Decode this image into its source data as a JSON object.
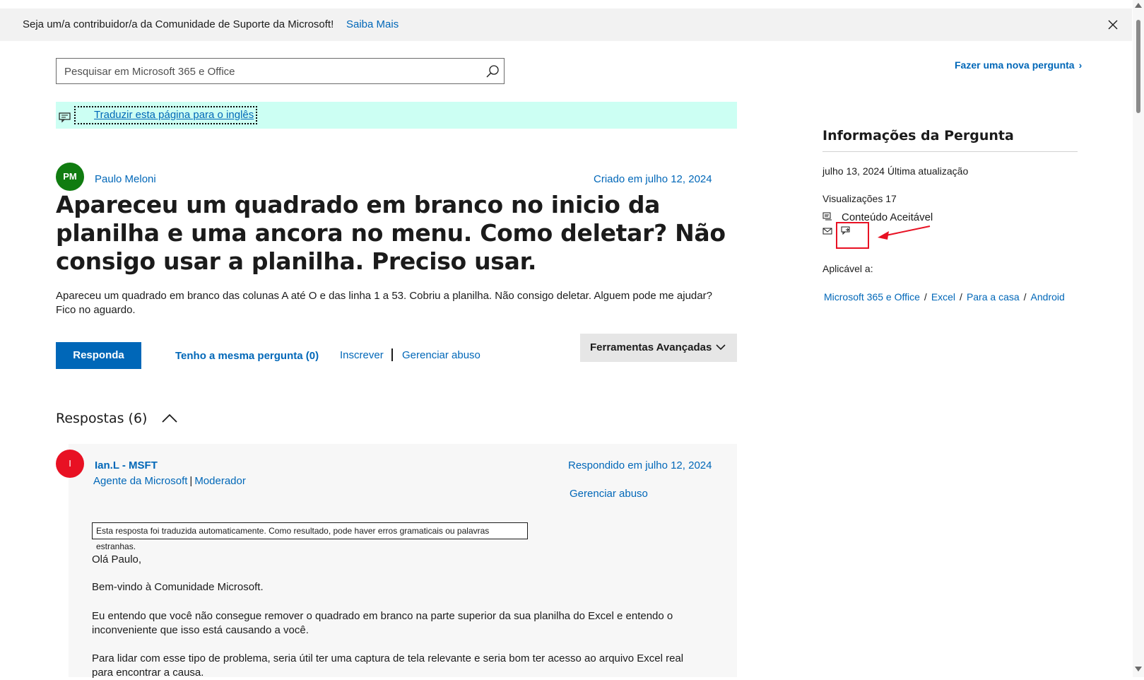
{
  "banner": {
    "text": "Seja um/a contribuidor/a da Comunidade de Suporte da Microsoft!",
    "link": "Saiba Mais",
    "close_icon": "close-icon"
  },
  "search": {
    "placeholder": "Pesquisar em Microsoft 365 e Office",
    "icon": "search-icon"
  },
  "new_question": {
    "label": "Fazer uma nova pergunta",
    "chevron": "›"
  },
  "translate": {
    "label": "Traduzir esta página para o inglês",
    "icon": "translate-icon"
  },
  "question": {
    "author_initials": "PM",
    "author": "Paulo Meloni",
    "created": "Criado em julho 12, 2024",
    "title": "Apareceu um quadrado em branco no inicio da planilha e uma ancora no menu. Como deletar? Não consigo usar a planilha. Preciso usar.",
    "body": "Apareceu um quadrado em branco das colunas A até O e das linha 1 a 53. Cobriu a planilha. Não consigo deletar. Alguem pode me ajudar? Fico no aguardo."
  },
  "actions": {
    "reply": "Responda",
    "same_question": "Tenho a mesma pergunta (0)",
    "subscribe": "Inscrever",
    "manage_abuse": "Gerenciar abuso",
    "advanced_tools": "Ferramentas Avançadas"
  },
  "answers": {
    "heading": "Respostas (6)",
    "items": [
      {
        "initials": "I",
        "name": "Ian.L - MSFT",
        "role1": "Agente da Microsoft",
        "role2": "Moderador",
        "date": "Respondido em julho 12, 2024",
        "manage_abuse": "Gerenciar abuso",
        "notice": "Esta resposta foi traduzida automaticamente. Como resultado, pode haver erros gramaticais ou palavras estranhas.",
        "paragraphs": [
          "Olá Paulo,",
          "Bem-vindo à Comunidade Microsoft.",
          "Eu entendo que você não consegue remover o quadrado em branco na parte superior da sua planilha do Excel e entendo o inconveniente que isso está causando a você.",
          "Para lidar com esse tipo de problema, seria útil ter uma captura de tela relevante e seria bom ter acesso ao arquivo Excel real para encontrar a causa."
        ]
      }
    ]
  },
  "sidebar": {
    "heading": "Informações da Pergunta",
    "updated": "julho 13, 2024 Última atualização",
    "views": "Visualizações 17",
    "accepted": "Conteúdo Aceitável",
    "applies_to": "Aplicável a:",
    "breadcrumbs": [
      "Microsoft 365 e Office",
      "Excel",
      "Para a casa",
      "Android"
    ],
    "highlight_color": "#e81123"
  },
  "colors": {
    "link": "#0067b8",
    "translate_bg": "#ccfff3",
    "reply_btn": "#0067b8"
  }
}
